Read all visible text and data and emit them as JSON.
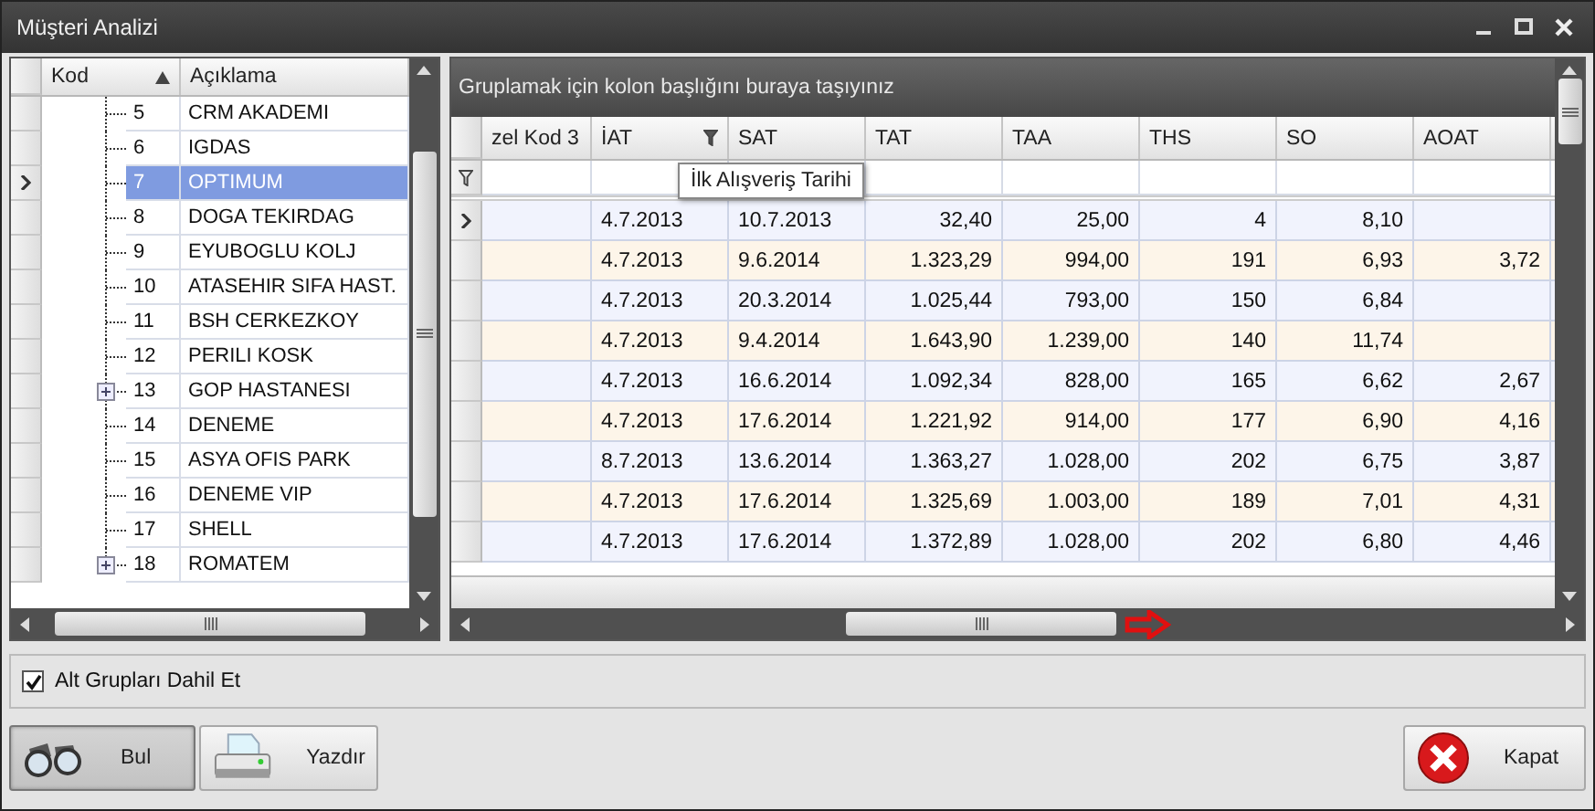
{
  "window": {
    "title": "Müşteri Analizi"
  },
  "tree": {
    "columns": [
      {
        "label": "Kod",
        "sorted": true
      },
      {
        "label": "Açıklama",
        "sorted": false
      }
    ],
    "rows": [
      {
        "code": "5",
        "name": "CRM AKADEMI",
        "selected": false,
        "expandable": false
      },
      {
        "code": "6",
        "name": "IGDAS",
        "selected": false,
        "expandable": false
      },
      {
        "code": "7",
        "name": "OPTIMUM",
        "selected": true,
        "expandable": false
      },
      {
        "code": "8",
        "name": "DOGA TEKIRDAG",
        "selected": false,
        "expandable": false
      },
      {
        "code": "9",
        "name": "EYUBOGLU KOLJ",
        "selected": false,
        "expandable": false
      },
      {
        "code": "10",
        "name": "ATASEHIR SIFA HAST.",
        "selected": false,
        "expandable": false
      },
      {
        "code": "11",
        "name": "BSH CERKEZKOY",
        "selected": false,
        "expandable": false
      },
      {
        "code": "12",
        "name": "PERILI KOSK",
        "selected": false,
        "expandable": false
      },
      {
        "code": "13",
        "name": "GOP HASTANESI",
        "selected": false,
        "expandable": true
      },
      {
        "code": "14",
        "name": "DENEME",
        "selected": false,
        "expandable": false
      },
      {
        "code": "15",
        "name": "ASYA OFIS PARK",
        "selected": false,
        "expandable": false
      },
      {
        "code": "16",
        "name": "DENEME VIP",
        "selected": false,
        "expandable": false
      },
      {
        "code": "17",
        "name": "SHELL",
        "selected": false,
        "expandable": false
      },
      {
        "code": "18",
        "name": "ROMATEM",
        "selected": false,
        "expandable": true
      }
    ]
  },
  "grid": {
    "group_panel": "Gruplamak için kolon başlığını buraya taşıyınız",
    "columns": [
      {
        "label": "zel Kod 3",
        "kind": "text",
        "filtered": false
      },
      {
        "label": "İAT",
        "kind": "date",
        "filtered": true
      },
      {
        "label": "SAT",
        "kind": "date",
        "filtered": false
      },
      {
        "label": "TAT",
        "kind": "number",
        "filtered": false
      },
      {
        "label": "TAA",
        "kind": "number",
        "filtered": false
      },
      {
        "label": "THS",
        "kind": "number",
        "filtered": false
      },
      {
        "label": "SO",
        "kind": "number",
        "filtered": false
      },
      {
        "label": "AOAT",
        "kind": "number",
        "filtered": false
      }
    ],
    "tooltip": "İlk Alışveriş Tarihi",
    "rows": [
      {
        "selected": true,
        "cells": [
          null,
          "4.7.2013",
          "10.7.2013",
          "32,40",
          "25,00",
          "4",
          "8,10",
          null
        ]
      },
      {
        "selected": false,
        "cells": [
          null,
          "4.7.2013",
          "9.6.2014",
          "1.323,29",
          "994,00",
          "191",
          "6,93",
          "3,72"
        ]
      },
      {
        "selected": false,
        "cells": [
          null,
          "4.7.2013",
          "20.3.2014",
          "1.025,44",
          "793,00",
          "150",
          "6,84",
          null
        ]
      },
      {
        "selected": false,
        "cells": [
          null,
          "4.7.2013",
          "9.4.2014",
          "1.643,90",
          "1.239,00",
          "140",
          "11,74",
          null
        ]
      },
      {
        "selected": false,
        "cells": [
          null,
          "4.7.2013",
          "16.6.2014",
          "1.092,34",
          "828,00",
          "165",
          "6,62",
          "2,67"
        ]
      },
      {
        "selected": false,
        "cells": [
          null,
          "4.7.2013",
          "17.6.2014",
          "1.221,92",
          "914,00",
          "177",
          "6,90",
          "4,16"
        ]
      },
      {
        "selected": false,
        "cells": [
          null,
          "8.7.2013",
          "13.6.2014",
          "1.363,27",
          "1.028,00",
          "202",
          "6,75",
          "3,87"
        ]
      },
      {
        "selected": false,
        "cells": [
          null,
          "4.7.2013",
          "17.6.2014",
          "1.325,69",
          "1.003,00",
          "189",
          "7,01",
          "4,31"
        ]
      },
      {
        "selected": false,
        "cells": [
          null,
          "4.7.2013",
          "17.6.2014",
          "1.372,89",
          "1.028,00",
          "202",
          "6,80",
          "4,46"
        ]
      }
    ]
  },
  "option": {
    "label": "Alt Grupları Dahil Et",
    "checked": true
  },
  "buttons": [
    {
      "label": "Bul",
      "focused": true
    },
    {
      "label": "Yazdır",
      "focused": false
    }
  ],
  "close_button": {
    "label": "Kapat"
  }
}
